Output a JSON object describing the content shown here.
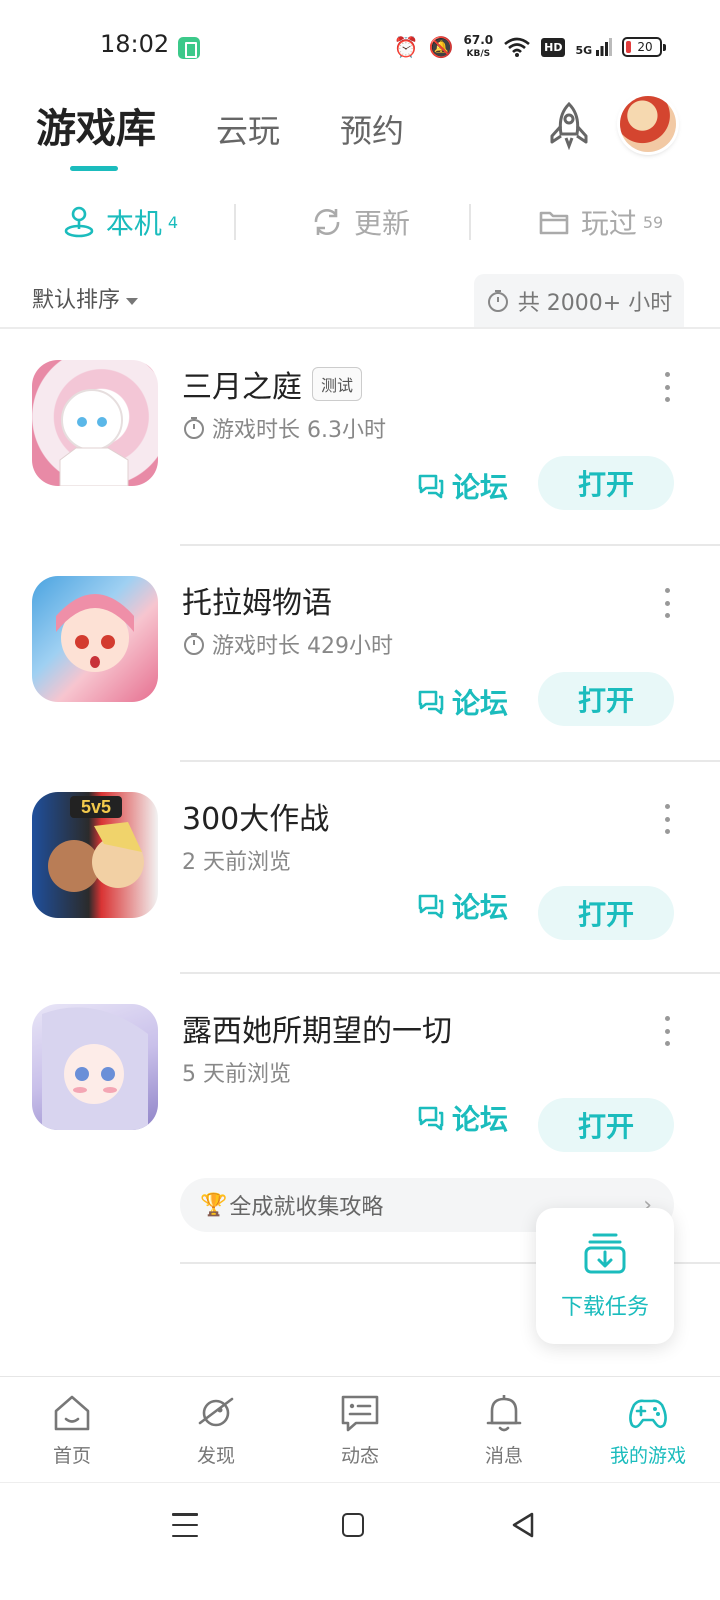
{
  "status_bar": {
    "time": "18:02",
    "net_speed_value": "67.0",
    "net_speed_unit": "KB/S",
    "hd": "HD",
    "signal": "5G",
    "battery": "20"
  },
  "header": {
    "tabs": [
      {
        "label": "游戏库",
        "active": true
      },
      {
        "label": "云玩",
        "active": false
      },
      {
        "label": "预约",
        "active": false
      }
    ]
  },
  "sub_tabs": [
    {
      "label": "本机",
      "count": "4",
      "icon": "local-device-icon",
      "active": true
    },
    {
      "label": "更新",
      "count": "",
      "icon": "refresh-icon",
      "active": false
    },
    {
      "label": "玩过",
      "count": "59",
      "icon": "folder-icon",
      "active": false
    }
  ],
  "sort": {
    "label": "默认排序",
    "total_time": "共 2000+ 小时"
  },
  "games": [
    {
      "title": "三月之庭",
      "tag": "测试",
      "subtitle": "游戏时长 6.3小时",
      "has_timer": true,
      "forum": "论坛",
      "open": "打开"
    },
    {
      "title": "托拉姆物语",
      "tag": "",
      "subtitle": "游戏时长 429小时",
      "has_timer": true,
      "forum": "论坛",
      "open": "打开"
    },
    {
      "title": "300大作战",
      "tag": "",
      "subtitle": "2 天前浏览",
      "has_timer": false,
      "forum": "论坛",
      "open": "打开"
    },
    {
      "title": "露西她所期望的一切",
      "tag": "",
      "subtitle": "5 天前浏览",
      "has_timer": false,
      "forum": "论坛",
      "open": "打开"
    }
  ],
  "guide": {
    "text": "全成就收集攻略"
  },
  "download_task": {
    "label": "下载任务"
  },
  "bottom_nav": [
    {
      "label": "首页",
      "icon": "home-icon",
      "active": false
    },
    {
      "label": "发现",
      "icon": "planet-icon",
      "active": false
    },
    {
      "label": "动态",
      "icon": "chat-icon",
      "active": false
    },
    {
      "label": "消息",
      "icon": "bell-icon",
      "active": false
    },
    {
      "label": "我的游戏",
      "icon": "gamepad-icon",
      "active": true
    }
  ],
  "colors": {
    "accent": "#1bbcbd",
    "accent_light": "#e8f8f8"
  }
}
